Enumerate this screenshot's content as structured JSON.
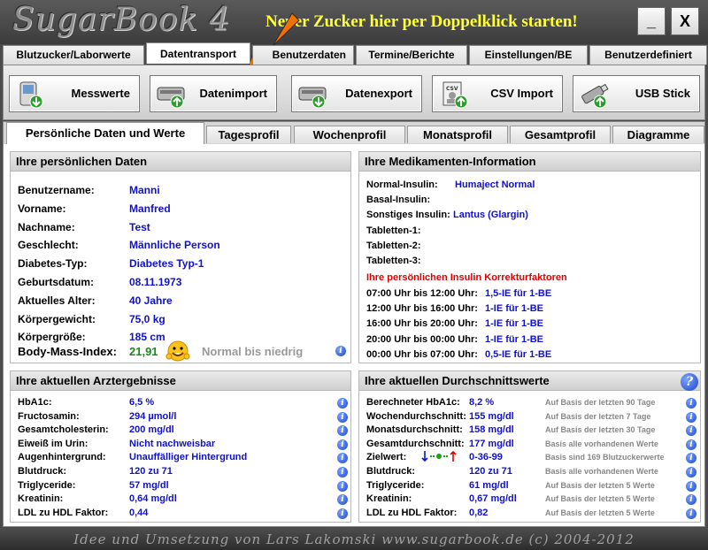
{
  "titlebar": {
    "logo": "SugarBook 4",
    "promo": "Neuer Zucker hier per Doppelklick starten!",
    "minimize": "_",
    "close": "X"
  },
  "main_tabs": [
    "Blutzucker/Laborwerte",
    "Datentransport",
    "Benutzerdaten",
    "Termine/Berichte",
    "Einstellungen/BE",
    "Benutzerdefiniert"
  ],
  "toolbar": [
    "Messwerte",
    "Datenimport",
    "Datenexport",
    "CSV Import",
    "USB Stick"
  ],
  "sub_tabs": [
    "Persönliche Daten und Werte",
    "Tagesprofil",
    "Wochenprofil",
    "Monatsprofil",
    "Gesamtprofil",
    "Diagramme"
  ],
  "personal": {
    "title": "Ihre persönlichen Daten",
    "rows": [
      [
        "Benutzername:",
        "Manni"
      ],
      [
        "Vorname:",
        "Manfred"
      ],
      [
        "Nachname:",
        "Test"
      ],
      [
        "Geschlecht:",
        "Männliche Person"
      ],
      [
        "Diabetes-Typ:",
        "Diabetes Typ-1"
      ],
      [
        "Geburtsdatum:",
        "08.11.1973"
      ],
      [
        "Aktuelles Alter:",
        "40 Jahre"
      ],
      [
        "Körpergewicht:",
        "75,0 kg"
      ],
      [
        "Körpergröße:",
        "185 cm"
      ]
    ],
    "bmi_label": "Body-Mass-Index:",
    "bmi_value": "21,91",
    "bmi_text": "Normal bis niedrig"
  },
  "meds": {
    "title": "Ihre Medikamenten-Information",
    "rows": [
      [
        "Normal-Insulin:",
        "Humaject Normal"
      ],
      [
        "Basal-Insulin:",
        ""
      ],
      [
        "Sonstiges Insulin:",
        "Lantus (Glargin)"
      ],
      [
        "Tabletten-1:",
        ""
      ],
      [
        "Tabletten-2:",
        ""
      ],
      [
        "Tabletten-3:",
        ""
      ]
    ],
    "correction_title": "Ihre persönlichen Insulin Korrekturfaktoren",
    "corrections": [
      [
        "07:00 Uhr bis 12:00 Uhr:",
        "1,5-IE für 1-BE"
      ],
      [
        "12:00 Uhr bis 16:00 Uhr:",
        "1-IE für 1-BE"
      ],
      [
        "16:00 Uhr bis 20:00 Uhr:",
        "1-IE für 1-BE"
      ],
      [
        "20:00 Uhr bis 00:00 Uhr:",
        "1-IE für 1-BE"
      ],
      [
        "00:00 Uhr bis 07:00 Uhr:",
        "0,5-IE für 1-BE"
      ]
    ]
  },
  "doctor": {
    "title": "Ihre aktuellen Arztergebnisse",
    "rows": [
      [
        "HbA1c:",
        "6,5 %"
      ],
      [
        "Fructosamin:",
        "294 µmol/l"
      ],
      [
        "Gesamtcholesterin:",
        "200 mg/dl"
      ],
      [
        "Eiweiß im Urin:",
        "Nicht nachweisbar"
      ],
      [
        "Augenhintergrund:",
        "Unauffälliger Hintergrund"
      ],
      [
        "Blutdruck:",
        "120 zu 71"
      ],
      [
        "Triglyceride:",
        "57 mg/dl"
      ],
      [
        "Kreatinin:",
        "0,64 mg/dl"
      ],
      [
        "LDL zu HDL Faktor:",
        "0,44"
      ]
    ]
  },
  "averages": {
    "title": "Ihre aktuellen Durchschnittswerte",
    "rows": [
      [
        "Berechneter HbA1c:",
        "8,2 %",
        "Auf Basis der letzten 90 Tage"
      ],
      [
        "Wochendurchschnitt:",
        "155 mg/dl",
        "Auf Basis der letzten 7 Tage"
      ],
      [
        "Monatsdurchschnitt:",
        "158 mg/dl",
        "Auf Basis der letzten 30 Tage"
      ],
      [
        "Gesamtdurchschnitt:",
        "177 mg/dl",
        "Basis alle vorhandenen Werte"
      ],
      [
        "Zielwert:",
        "0-36-99",
        "Basis sind 169  Blutzuckerwerte"
      ],
      [
        "Blutdruck:",
        "120 zu 71",
        "Basis alle vorhandenen Werte"
      ],
      [
        "Triglyceride:",
        "61 mg/dl",
        "Auf Basis der letzten 5 Werte"
      ],
      [
        "Kreatinin:",
        "0,67 mg/dl",
        "Auf Basis der letzten 5 Werte"
      ],
      [
        "LDL zu HDL Faktor:",
        "0,82",
        "Auf Basis der letzten 5 Werte"
      ]
    ]
  },
  "footer": "Idee und Umsetzung von Lars Lakomski www.sugarbook.de (c) 2004-2012",
  "colors": {
    "value": "#1010d0",
    "correction_title": "#e00000",
    "bmi": "#1a8a1a",
    "promo": "#ffff33"
  }
}
